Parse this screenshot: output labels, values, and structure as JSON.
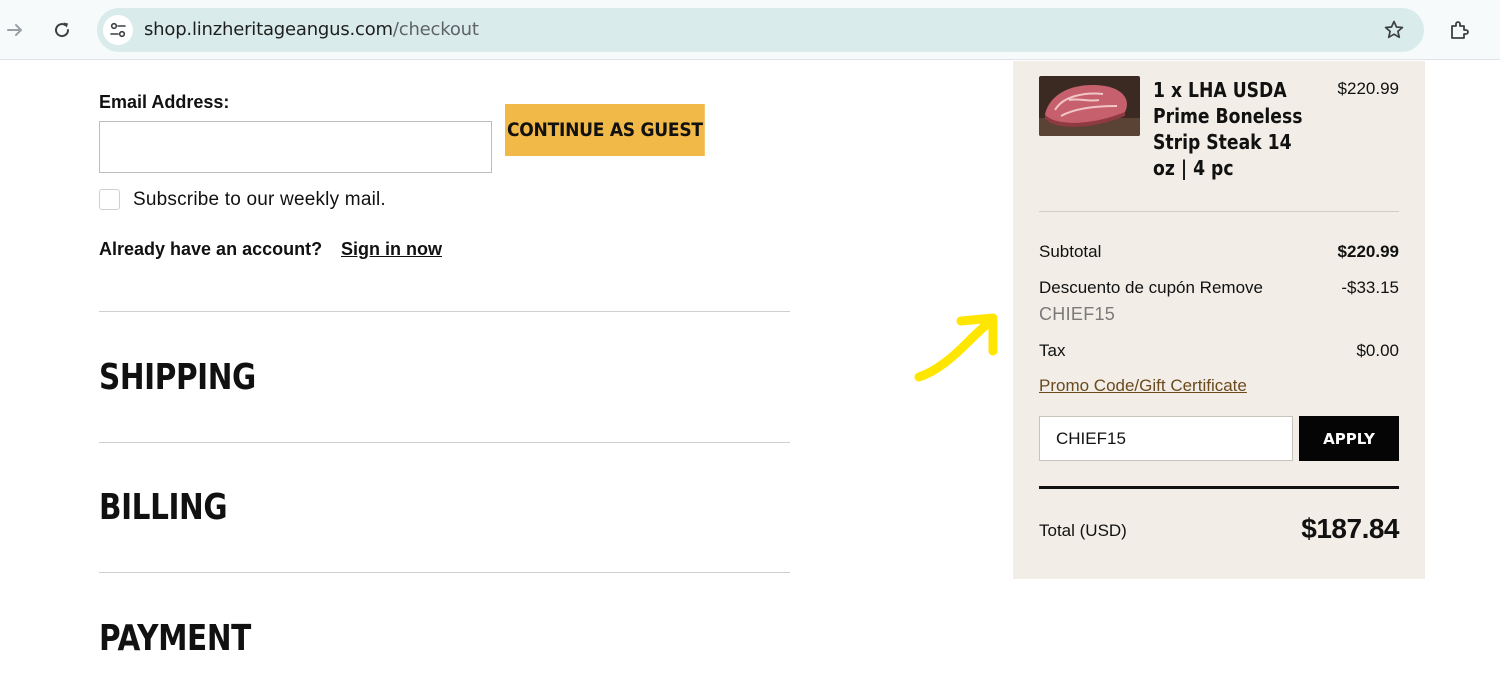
{
  "browser": {
    "url_domain": "shop.linzheritageangus.com",
    "url_path": "/checkout"
  },
  "customer": {
    "email_label": "Email Address:",
    "email_value": "",
    "continue_button": "CONTINUE AS GUEST",
    "subscribe_label": "Subscribe to our weekly mail.",
    "subscribe_checked": false,
    "account_prompt": "Already have an account?",
    "sign_in_link": "Sign in now"
  },
  "sections": {
    "shipping": "SHIPPING",
    "billing": "BILLING",
    "payment": "PAYMENT"
  },
  "summary": {
    "item": {
      "name": "1 x LHA USDA Prime Boneless Strip Steak 14 oz | 4 pc",
      "price": "$220.99"
    },
    "subtotal_label": "Subtotal",
    "subtotal_value": "$220.99",
    "discount_label": "Descuento de cupón Remove",
    "discount_value": "-$33.15",
    "discount_code": "CHIEF15",
    "tax_label": "Tax",
    "tax_value": "$0.00",
    "promo_link": "Promo Code/Gift Certificate",
    "promo_input_value": "CHIEF15",
    "apply_button": "APPLY",
    "total_label": "Total (USD)",
    "total_value": "$187.84"
  },
  "colors": {
    "accent_button": "#f1b947",
    "summary_bg": "#f2eee7",
    "annotation_arrow": "#ffe600",
    "promo_link": "#6b4a1f"
  }
}
